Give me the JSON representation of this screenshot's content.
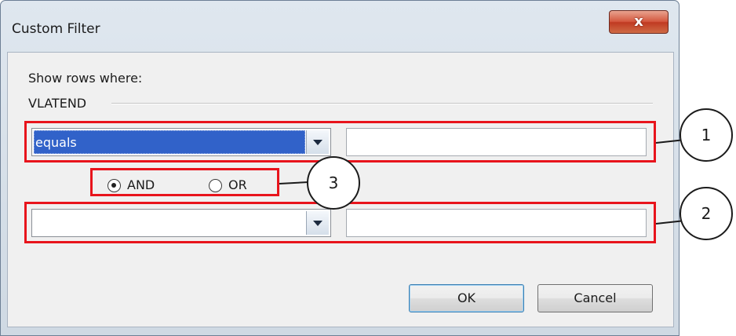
{
  "window": {
    "title": "Custom Filter",
    "close_glyph": "x"
  },
  "labels": {
    "show_rows": "Show rows where:",
    "column": "VLATEND"
  },
  "row1": {
    "operator": "equals",
    "value": ""
  },
  "row2": {
    "operator": "",
    "value": ""
  },
  "logic": {
    "and_label": "AND",
    "or_label": "OR",
    "selected": "AND"
  },
  "buttons": {
    "ok": "OK",
    "cancel": "Cancel"
  },
  "callouts": {
    "one": "1",
    "two": "2",
    "three": "3"
  },
  "colors": {
    "highlight": "#e8141c",
    "selection": "#3162c9"
  }
}
